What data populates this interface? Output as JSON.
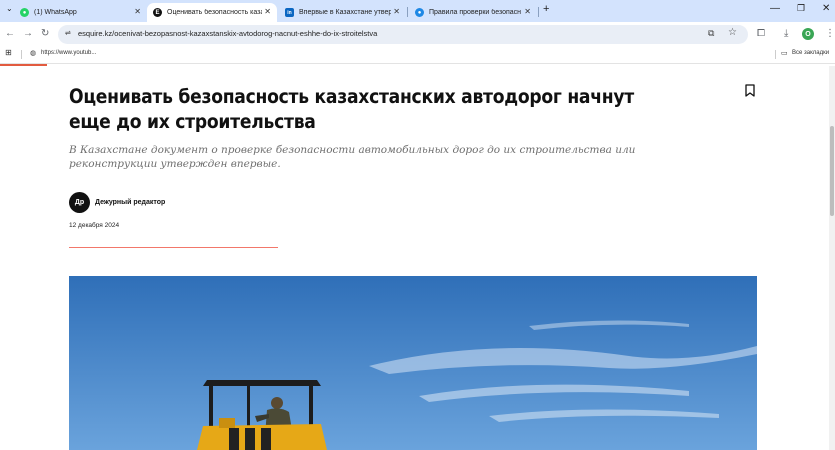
{
  "browser": {
    "tabs": [
      {
        "label": "(1) WhatsApp",
        "icon": "whatsapp-icon",
        "color": "#25d366",
        "glyph": "●"
      },
      {
        "label": "Оценивать безопасность каза",
        "icon": "esquire-icon",
        "color": "#111111",
        "glyph": "E"
      },
      {
        "label": "Впервые в Казахстане утверд",
        "icon": "linkedin-icon",
        "color": "#0a66c2",
        "glyph": "in"
      },
      {
        "label": "Правила проверки безопасн",
        "icon": "site-icon",
        "color": "#1e88e5",
        "glyph": "●"
      }
    ],
    "new_tab": "+",
    "window_controls": {
      "minimize": "—",
      "restore": "❐",
      "close": "✕"
    },
    "url": "esquire.kz/ocenivat-bezopasnost-kazaxstanskix-avtodorog-nacnut-eshhe-do-ix-stroitelstva",
    "profile_initial": "O",
    "bookmarks": {
      "item": "https://www.youtub...",
      "all_bookmarks": "Все закладки"
    }
  },
  "article": {
    "headline": "Оценивать безопасность казахстанских автодорог начнут еще до их строительства",
    "lead": "В Казахстане документ о проверке безопасности автомобильных дорог до их строительства или реконструкции утвержден впервые.",
    "author_initials": "Др",
    "author_name": "Дежурный редактор",
    "date": "12 декабря 2024"
  },
  "colors": {
    "tabstrip": "#d3e3fd",
    "accent_red": "#e25b3f",
    "sky": "#3f7fc4",
    "machine_yellow": "#e6a817"
  }
}
